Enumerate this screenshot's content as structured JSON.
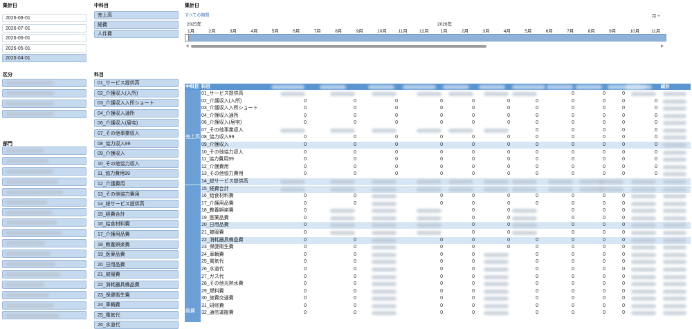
{
  "date_slicer": {
    "title": "集計日",
    "items": [
      {
        "label": "2026-08-01",
        "selected": false
      },
      {
        "label": "2026-07-01",
        "selected": false
      },
      {
        "label": "2026-06-01",
        "selected": false
      },
      {
        "label": "2026-05-01",
        "selected": false
      },
      {
        "label": "2026-04-01",
        "selected": true
      }
    ]
  },
  "category_slicer": {
    "title": "中科目",
    "items": [
      {
        "label": "売上高"
      },
      {
        "label": "経費"
      },
      {
        "label": "人件費"
      }
    ]
  },
  "timeline": {
    "title": "集計日",
    "all_periods": "すべての期間",
    "granularity": "月",
    "years": [
      "2025年",
      "2026年"
    ],
    "months": [
      "1月",
      "2月",
      "3月",
      "4月",
      "5月",
      "6月",
      "7月",
      "8月",
      "9月",
      "10月",
      "11月",
      "12月",
      "1月",
      "2月",
      "3月",
      "4月",
      "5月",
      "6月",
      "7月",
      "8月",
      "9月",
      "10月",
      "11月"
    ]
  },
  "division_slicer": {
    "title": "区分"
  },
  "department_slicer": {
    "title": "部門"
  },
  "subject_slicer": {
    "title": "科目",
    "items": [
      "01_サービス提供高",
      "02_介護収入(入所)",
      "03_介護収入入所ショート",
      "04_介護収入通所",
      "06_介護収入(居宅)",
      "07_その他事業収入",
      "08_協力収入99",
      "09_介護収入",
      "10_その他協力収入",
      "11_協力費用99",
      "12_介護費用",
      "13_その他協力費用",
      "14_総サービス提供高",
      "15_経費合計",
      "16_給食材料費",
      "17_介護用品費",
      "18_教養娯楽費",
      "19_医薬品費",
      "20_日用品費",
      "21_被服費",
      "22_消耗器具備品費",
      "23_保健衛生費",
      "24_車輌費",
      "25_電気代",
      "26_水道代"
    ]
  },
  "pivot": {
    "header_mid": "中科目",
    "header_subject": "科目",
    "header_total": "総計",
    "group_sales": "売上高",
    "group_expense": "経費",
    "rows": [
      "01_サービス提供高",
      "02_介護収入(入所)",
      "03_介護収入入所ショート",
      "04_介護収入通所",
      "06_介護収入(居宅)",
      "07_その他事業収入",
      "08_協力収入99",
      "09_介護収入",
      "10_その他協力収入",
      "11_協力費用99",
      "12_介護費用",
      "13_その他協力費用",
      "14_総サービス提供高",
      "15_経費合計",
      "16_給食材料費",
      "17_介護用品費",
      "18_教養娯楽費",
      "19_医薬品費",
      "20_日用品費",
      "21_被服費",
      "22_消耗器具備品費",
      "23_保健衛生費",
      "24_車輌費",
      "25_電気代",
      "26_水道代",
      "27_ガス代",
      "28_その他光熱水費",
      "29_燃料費",
      "30_旅費交通費",
      "31_研修費",
      "32_通信運搬費"
    ],
    "zero": "0"
  }
}
